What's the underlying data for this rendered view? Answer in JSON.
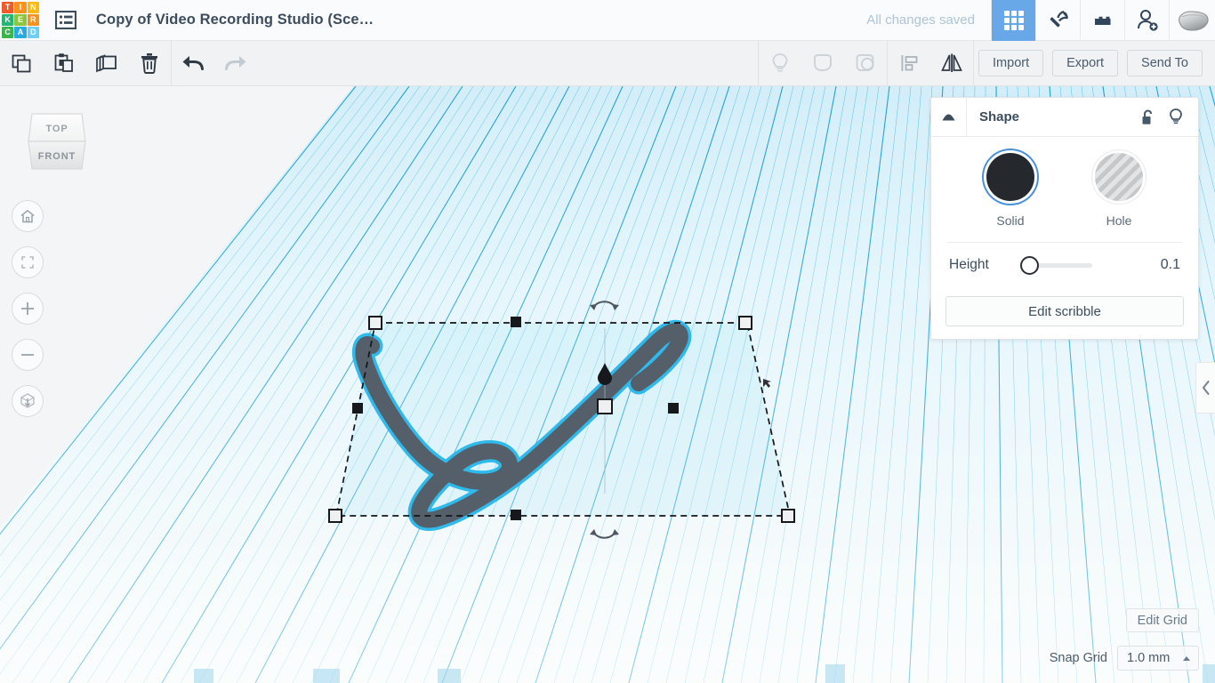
{
  "app": {
    "logo_letters": [
      "T",
      "I",
      "N",
      "K",
      "E",
      "R",
      "C",
      "A",
      "D"
    ],
    "logo_colors": [
      "#f05a28",
      "#f6921e",
      "#fdb913",
      "#22b573",
      "#8cc63f",
      "#f6921e",
      "#3ab54a",
      "#29abe2",
      "#6dcff6"
    ],
    "menu_icon": "list-menu-icon"
  },
  "header": {
    "title": "Copy of Video Recording Studio (Sce…",
    "save_status": "All changes saved",
    "icons": [
      {
        "name": "grid-gallery-icon",
        "active": true
      },
      {
        "name": "pickaxe-icon",
        "active": false
      },
      {
        "name": "brick-blocks-icon",
        "active": false
      },
      {
        "name": "add-person-icon",
        "active": false
      },
      {
        "name": "mesh-blob-icon",
        "active": false
      }
    ]
  },
  "toolbar": {
    "left_tools": [
      {
        "name": "copy-icon",
        "disabled": false
      },
      {
        "name": "paste-icon",
        "disabled": false
      },
      {
        "name": "duplicate-icon",
        "disabled": false
      },
      {
        "name": "delete-trash-icon",
        "disabled": false
      }
    ],
    "history_tools": [
      {
        "name": "undo-icon",
        "disabled": false
      },
      {
        "name": "redo-icon",
        "disabled": true
      }
    ],
    "right_tools": [
      {
        "name": "lightbulb-icon",
        "disabled": true
      },
      {
        "name": "group-icon",
        "disabled": true
      },
      {
        "name": "ungroup-icon",
        "disabled": true
      },
      {
        "name": "align-icon",
        "disabled": false
      },
      {
        "name": "mirror-flip-icon",
        "disabled": false
      }
    ],
    "buttons": [
      {
        "name": "import-button",
        "label": "Import"
      },
      {
        "name": "export-button",
        "label": "Export"
      },
      {
        "name": "send-to-button",
        "label": "Send To"
      }
    ]
  },
  "viewcube": {
    "top_label": "TOP",
    "front_label": "FRONT"
  },
  "nav_buttons": [
    {
      "name": "home-view-button",
      "icon": "home-icon"
    },
    {
      "name": "fit-to-view-button",
      "icon": "fit-brackets-icon"
    },
    {
      "name": "zoom-in-button",
      "icon": "plus-icon"
    },
    {
      "name": "zoom-out-button",
      "icon": "minus-icon"
    },
    {
      "name": "perspective-toggle-button",
      "icon": "cube-arrow-icon"
    }
  ],
  "shape_panel": {
    "title": "Shape",
    "collapse_icon": "triangle-up-icon",
    "lock_icon": "unlocked-padlock-icon",
    "light_icon": "lightbulb-icon",
    "modes": [
      {
        "name": "solid-swatch",
        "label": "Solid",
        "selected": true,
        "color": "#25292e"
      },
      {
        "name": "hole-swatch",
        "label": "Hole",
        "selected": false,
        "color": "#c6c7c9"
      }
    ],
    "height": {
      "label": "Height",
      "value": "0.1",
      "slider_position_pct": 2
    },
    "edit_button": "Edit scribble"
  },
  "canvas": {
    "right_collapse_icon": "chevron-left-icon",
    "edit_grid_button": "Edit Grid",
    "snap_grid_label": "Snap Grid",
    "snap_grid_value": "1.0 mm",
    "snap_dropdown_icon": "caret-up-icon",
    "grid_color": "#3fb6e0",
    "plane_color": "#eaf7fc",
    "selection": {
      "object_name": "scribble-shape",
      "object_color": "#555f6a",
      "highlight_color": "#1fb0e8",
      "rotate_handle_top": "rotate-arc-icon",
      "rotate_handle_bottom": "rotate-arc-icon",
      "cone_handle": "height-cone-handle",
      "center_handle": "center-square-handle"
    }
  }
}
